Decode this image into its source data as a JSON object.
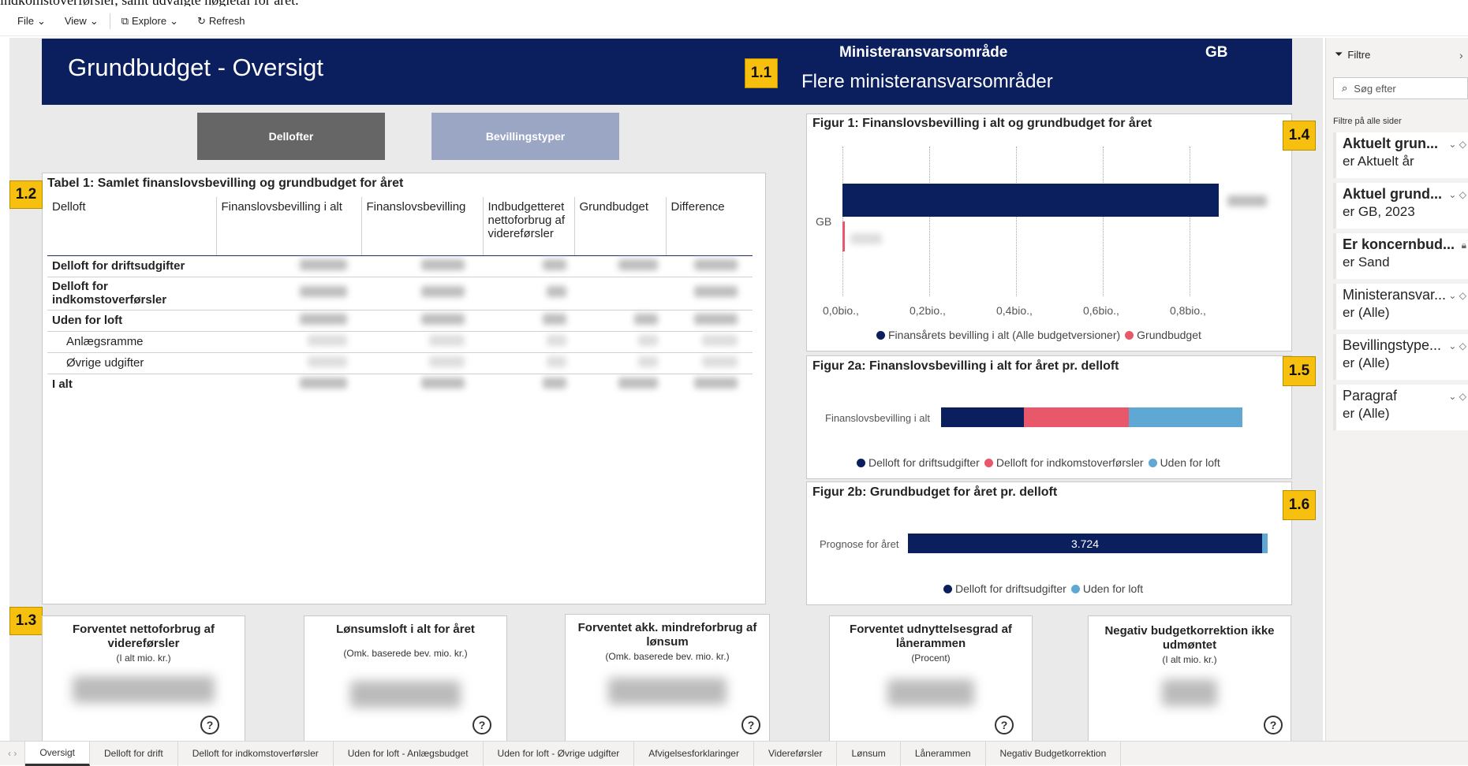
{
  "caption": "indkomstoverførsler, samt udvalgte nøgletal for året.",
  "toolbar": {
    "file": "File",
    "view": "View",
    "explore": "Explore",
    "refresh": "Refresh"
  },
  "header": {
    "title": "Grundbudget - Oversigt",
    "ministry_label": "Ministeransvarsområde",
    "ministry_value": "Flere ministeransvarsområder",
    "gb": "GB"
  },
  "badges": [
    "1.1",
    "1.2",
    "1.3",
    "1.4",
    "1.5",
    "1.6"
  ],
  "buttons": {
    "delofter": "Dellofter",
    "bevillingstyper": "Bevillingstyper"
  },
  "table1": {
    "title": "Tabel 1: Samlet finanslovsbevilling og grundbudget for året",
    "columns": [
      "Delloft",
      "Finanslovsbevilling i alt",
      "Finanslovsbevilling",
      "Indbudgetteret nettoforbrug af videreførsler",
      "Grundbudget",
      "Difference"
    ],
    "rows": [
      {
        "label": "Delloft for driftsudgifter",
        "style": "bold"
      },
      {
        "label": "Delloft for indkomstoverførsler",
        "style": "bold"
      },
      {
        "label": "Uden for loft",
        "style": "bold"
      },
      {
        "label": "Anlægsramme",
        "style": "sub"
      },
      {
        "label": "Øvrige udgifter",
        "style": "sub"
      },
      {
        "label": "I alt",
        "style": "bold"
      }
    ]
  },
  "fig1": {
    "title": "Figur 1: Finanslovsbevilling i alt og grundbudget for året",
    "category": "GB",
    "ticks": [
      "0,0bio.,",
      "0,2bio.,",
      "0,4bio.,",
      "0,6bio.,",
      "0,8bio.,"
    ],
    "legend": [
      "Finansårets bevilling i alt (Alle budgetversioner)",
      "Grundbudget"
    ]
  },
  "fig2a": {
    "title": "Figur 2a: Finanslovsbevilling i alt for året pr. delloft",
    "category": "Finanslovsbevilling i alt",
    "legend": [
      "Delloft for driftsudgifter",
      "Delloft for indkomstoverførsler",
      "Uden for loft"
    ]
  },
  "fig2b": {
    "title": "Figur 2b: Grundbudget for året pr. delloft",
    "category": "Prognose for året",
    "bar_label": "3.724",
    "legend": [
      "Delloft for driftsudgifter",
      "Uden for loft"
    ]
  },
  "kpis": [
    {
      "title": "Forventet nettoforbrug af videreførsler",
      "sub": "(I alt mio. kr.)"
    },
    {
      "title": "Lønsumsloft i alt for året",
      "sub": "(Omk. baserede bev. mio. kr.)"
    },
    {
      "title": "Forventet akk. mindreforbrug af lønsum",
      "sub": "(Omk. baserede bev. mio. kr.)"
    },
    {
      "title": "Forventet udnyttelsesgrad af lånerammen",
      "sub": "(Procent)"
    },
    {
      "title": "Negativ budgetkorrektion ikke udmøntet",
      "sub": "(I alt mio. kr.)"
    }
  ],
  "filters": {
    "header": "Filtre",
    "search_placeholder": "Søg efter",
    "section": "Filtre på alle sider",
    "cards": [
      {
        "title": "Aktuelt grun...",
        "value": "er Aktuelt år",
        "bold": true
      },
      {
        "title": "Aktuel grund...",
        "value": "er GB, 2023",
        "bold": true
      },
      {
        "title": "Er koncernbud...",
        "value": "er Sand",
        "bold": true
      },
      {
        "title": "Ministeransvar...",
        "value": "er (Alle)",
        "bold": false
      },
      {
        "title": "Bevillingstype...",
        "value": "er (Alle)",
        "bold": false
      },
      {
        "title": "Paragraf",
        "value": "er (Alle)",
        "bold": false
      }
    ]
  },
  "pages": [
    "Oversigt",
    "Delloft for drift",
    "Delloft for indkomstoverførsler",
    "Uden for loft - Anlægsbudget",
    "Uden for loft - Øvrige udgifter",
    "Afvigelsesforklaringer",
    "Videreførsler",
    "Lønsum",
    "Lånerammen",
    "Negativ Budgetkorrektion"
  ],
  "colors": {
    "navy": "#0b1f5e",
    "pink": "#e8586a",
    "lightblue": "#5fa8d3",
    "badge": "#f7c00f"
  }
}
